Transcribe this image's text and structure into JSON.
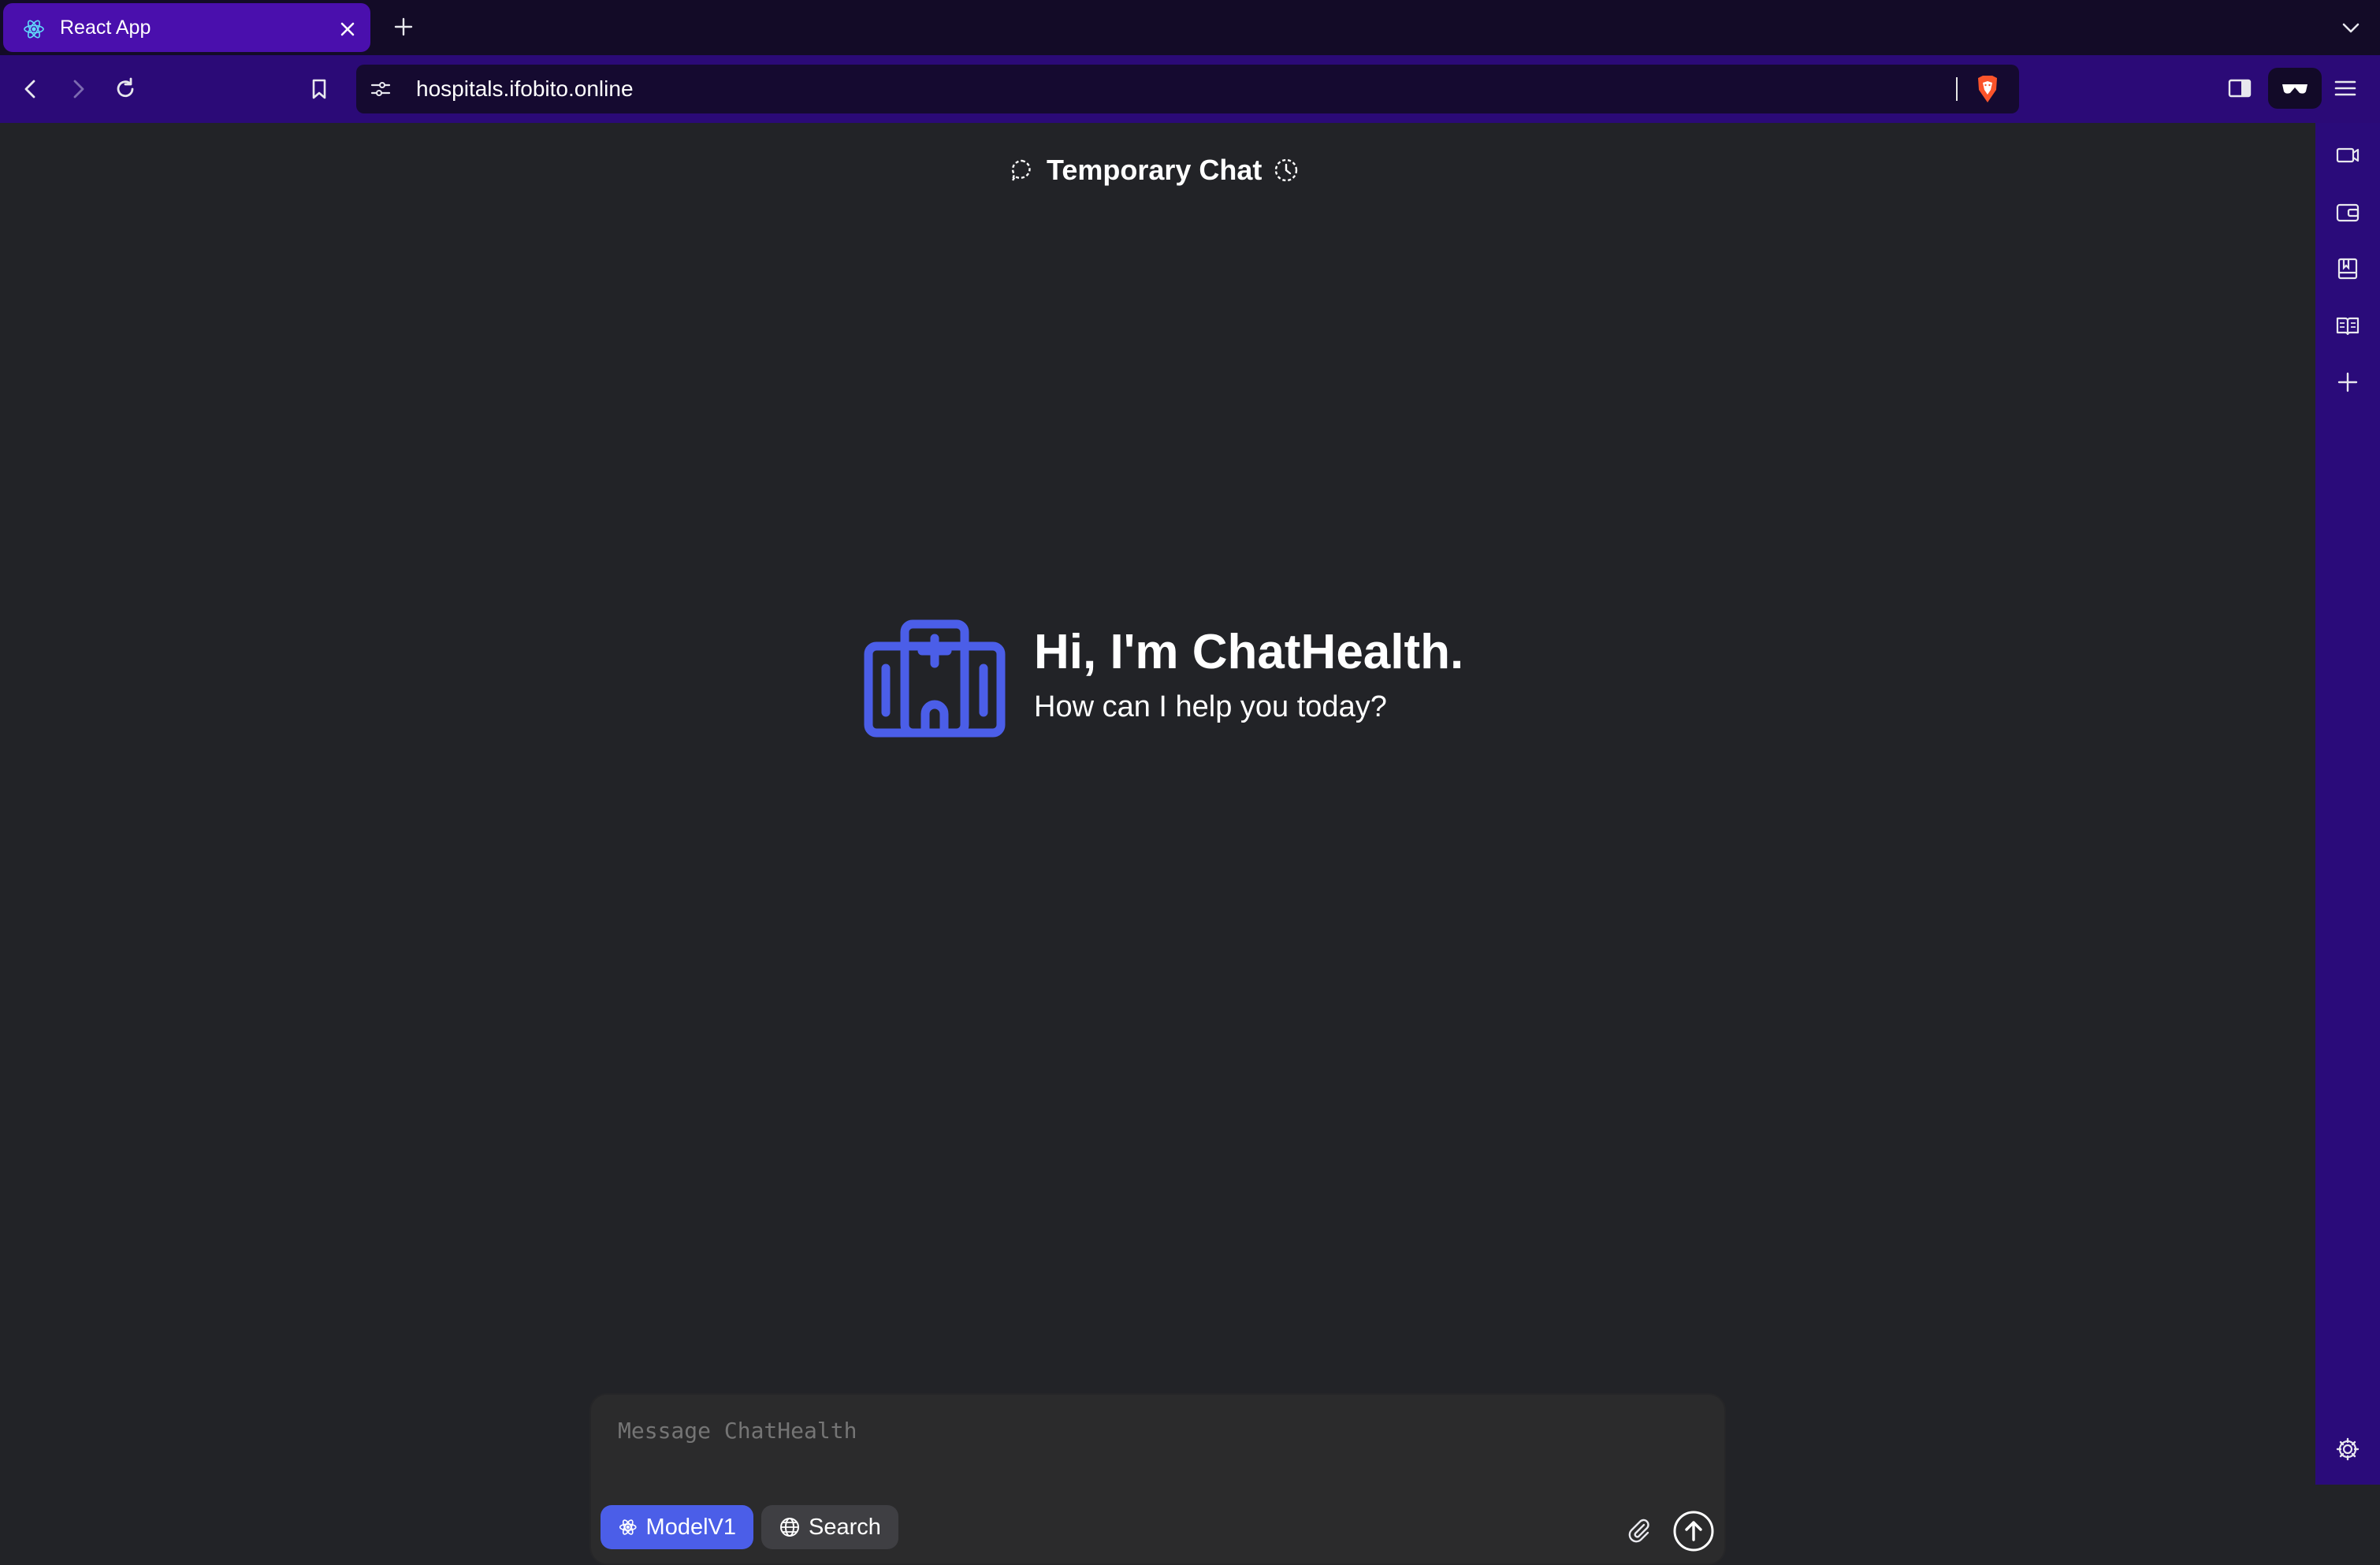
{
  "browser": {
    "tab_title": "React App",
    "url": "hospitals.ifobito.online"
  },
  "page": {
    "header_title": "Temporary Chat",
    "hero_title": "Hi, I'm ChatHealth.",
    "hero_subtitle": "How can I help you today?"
  },
  "composer": {
    "placeholder": "Message ChatHealth",
    "model_label": "ModelV1",
    "search_label": "Search"
  },
  "colors": {
    "accent": "#4b5ee8",
    "tab_active": "#4a0fad",
    "toolbar": "#2b0a77",
    "page_bg": "#222327"
  },
  "icons": {
    "tab": [
      "react-icon",
      "close-icon",
      "plus-icon",
      "chevron-down-icon"
    ],
    "nav": [
      "back-icon",
      "forward-icon",
      "reload-icon",
      "bookmark-icon",
      "site-info-icon",
      "brave-shield-icon",
      "sidebar-toggle-icon",
      "leo-icon",
      "menu-icon"
    ],
    "sidebar": [
      "camera-icon",
      "wallet-icon",
      "bookmarks-icon",
      "reading-list-icon",
      "add-icon",
      "settings-icon"
    ],
    "page": [
      "chat-bubble-icon",
      "history-icon",
      "hospital-logo-icon",
      "model-icon",
      "globe-icon",
      "paperclip-icon",
      "send-icon"
    ]
  }
}
